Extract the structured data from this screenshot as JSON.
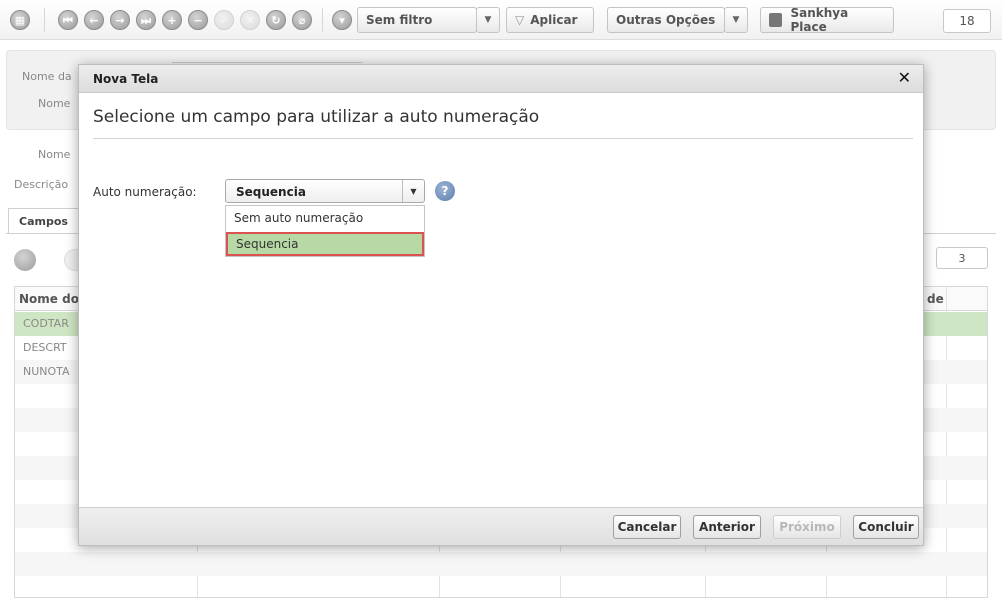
{
  "toolbar": {
    "filter_label": "Sem filtro",
    "apply_label": "Aplicar",
    "options_label": "Outras Opções",
    "place_label": "Sankhya Place",
    "record_count": "18"
  },
  "background": {
    "label_nome_da": "Nome da",
    "label_nome_1": "Nome",
    "label_nome_2": "Nome",
    "label_descricao": "Descrição",
    "tab_campos": "Campos",
    "grid_header_first": "Nome do",
    "grid_header_last": "de",
    "grid_rows": [
      "CODTAR",
      "DESCRT",
      "NUNOTA"
    ],
    "right_count": "3"
  },
  "modal": {
    "title": "Nova Tela",
    "close_glyph": "✕",
    "heading": "Selecione um campo para utilizar a auto numeração",
    "field_label": "Auto numeração:",
    "combo_value": "Sequencia",
    "help_glyph": "?",
    "options": [
      "Sem auto numeração",
      "Sequencia"
    ],
    "buttons": {
      "cancel": "Cancelar",
      "previous": "Anterior",
      "next": "Próximo",
      "finish": "Concluir"
    }
  },
  "colors": {
    "selected_row": "#cfe6c4",
    "highlight_option": "#b7d9a6",
    "highlight_border": "#d9534f"
  }
}
